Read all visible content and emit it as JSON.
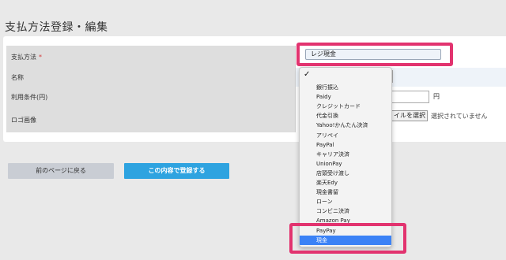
{
  "page": {
    "title": "支払方法登録・編集"
  },
  "form": {
    "rows": [
      {
        "label": "支払方法",
        "required_mark": "*"
      },
      {
        "label": "名称"
      },
      {
        "label": "利用条件(円)"
      },
      {
        "label": "ロゴ画像"
      }
    ],
    "payment_method_value": "レジ現金",
    "yen_unit": "円",
    "file_button_label": "イルを選択",
    "file_status": "選択されていません"
  },
  "buttons": {
    "back": "前のページに戻る",
    "submit": "この内容で登録する"
  },
  "dropdown": {
    "checkmark": "✓",
    "options": [
      "銀行振込",
      "Paidy",
      "クレジットカード",
      "代金引換",
      "Yahoo!かんたん決済",
      "アリペイ",
      "PayPal",
      "キャリア決済",
      "UnionPay",
      "店頭受け渡し",
      "楽天Edy",
      "現金書留",
      "ローン",
      "コンビニ決済",
      "Amazon Pay",
      "PayPay",
      "現金"
    ],
    "selected": "現金"
  },
  "colors": {
    "highlight": "#e2336f",
    "selected_option": "#3b82f6",
    "submit_button": "#2ea3e0"
  }
}
